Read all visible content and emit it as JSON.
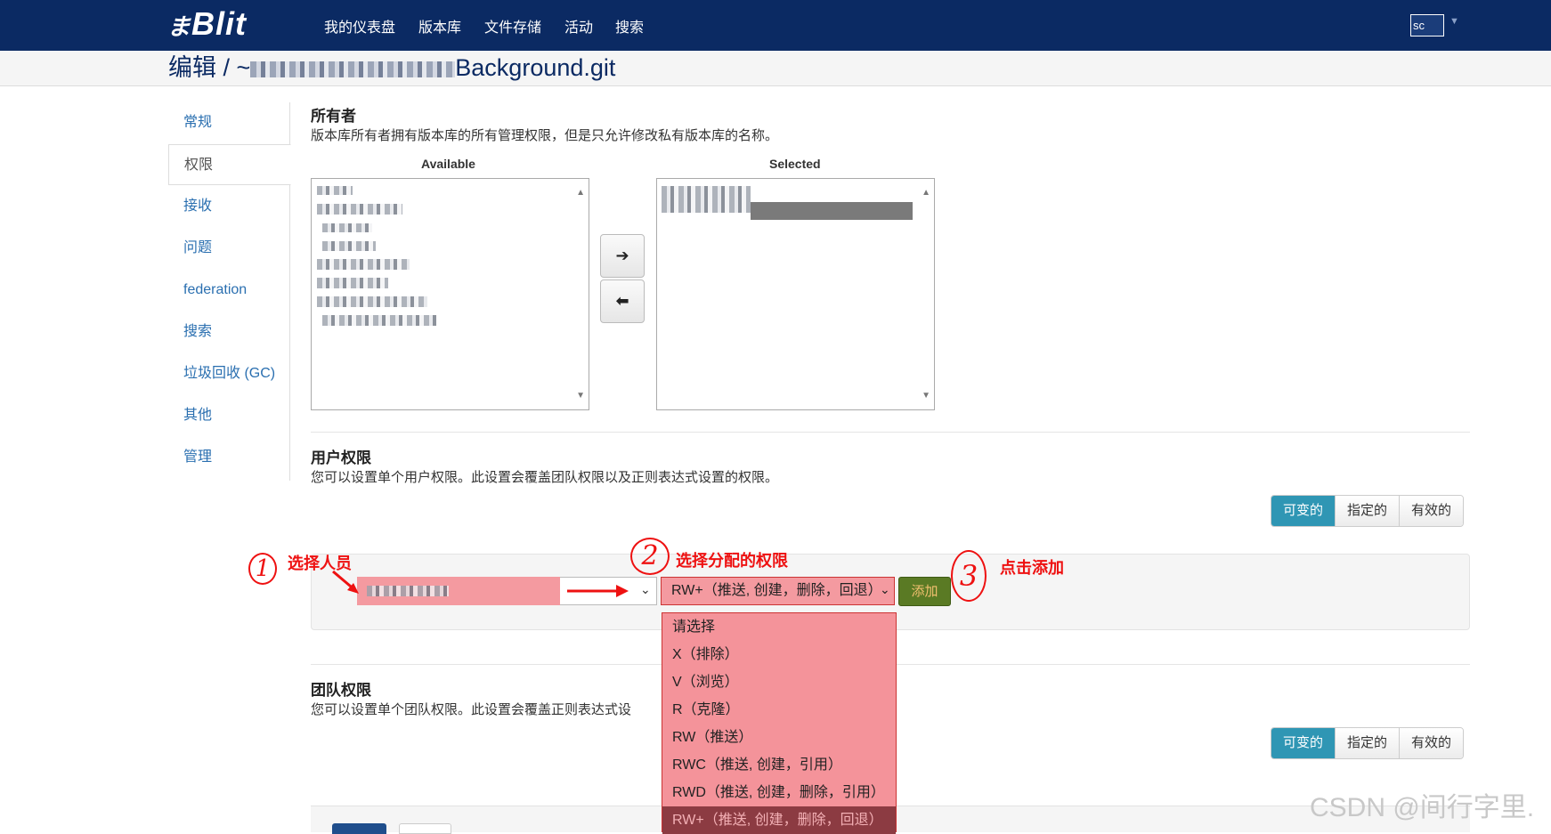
{
  "nav": {
    "brand": "Blit",
    "brand_glyph": "ま",
    "links": [
      "我的仪表盘",
      "版本库",
      "文件存储",
      "活动",
      "搜索"
    ],
    "avatar_alt": "sc"
  },
  "title": {
    "prefix": "编辑 / ~",
    "repo_suffix": "Background.git"
  },
  "sidebar": {
    "items": [
      "常规",
      "权限",
      "接收",
      "问题",
      "federation",
      "搜索",
      "垃圾回收 (GC)",
      "其他",
      "管理"
    ],
    "active": "权限"
  },
  "owners": {
    "title": "所有者",
    "desc": "版本库所有者拥有版本库的所有管理权限，但是只允许修改私有版本库的名称。",
    "available_label": "Available",
    "selected_label": "Selected",
    "move_right_icon": "arrow-right-icon",
    "move_left_icon": "arrow-left-icon"
  },
  "user_perms": {
    "title": "用户权限",
    "desc": "您可以设置单个用户权限。此设置会覆盖团队权限以及正则表达式设置的权限。",
    "tabs": [
      "可变的",
      "指定的",
      "有效的"
    ],
    "active_tab": "可变的",
    "selected_perm": "RW+（推送, 创建，删除，回退）",
    "add_label": "添加",
    "options": [
      "请选择",
      "X（排除）",
      "V（浏览）",
      "R（克隆）",
      "RW（推送）",
      "RWC（推送, 创建，引用）",
      "RWD（推送, 创建，删除，引用）",
      "RW+（推送, 创建，删除，回退）"
    ]
  },
  "team_perms": {
    "title": "团队权限",
    "desc": "您可以设置单个团队权限。此设置会覆盖正则表达式设",
    "tabs": [
      "可变的",
      "指定的",
      "有效的"
    ],
    "active_tab": "可变的"
  },
  "annotations": {
    "n1": "1",
    "n2": "2",
    "n3": "3",
    "label1": "选择人员",
    "label2": "选择分配的权限",
    "label3": "点击添加",
    "color": "#e11111"
  },
  "watermark": "CSDN @间行字里."
}
